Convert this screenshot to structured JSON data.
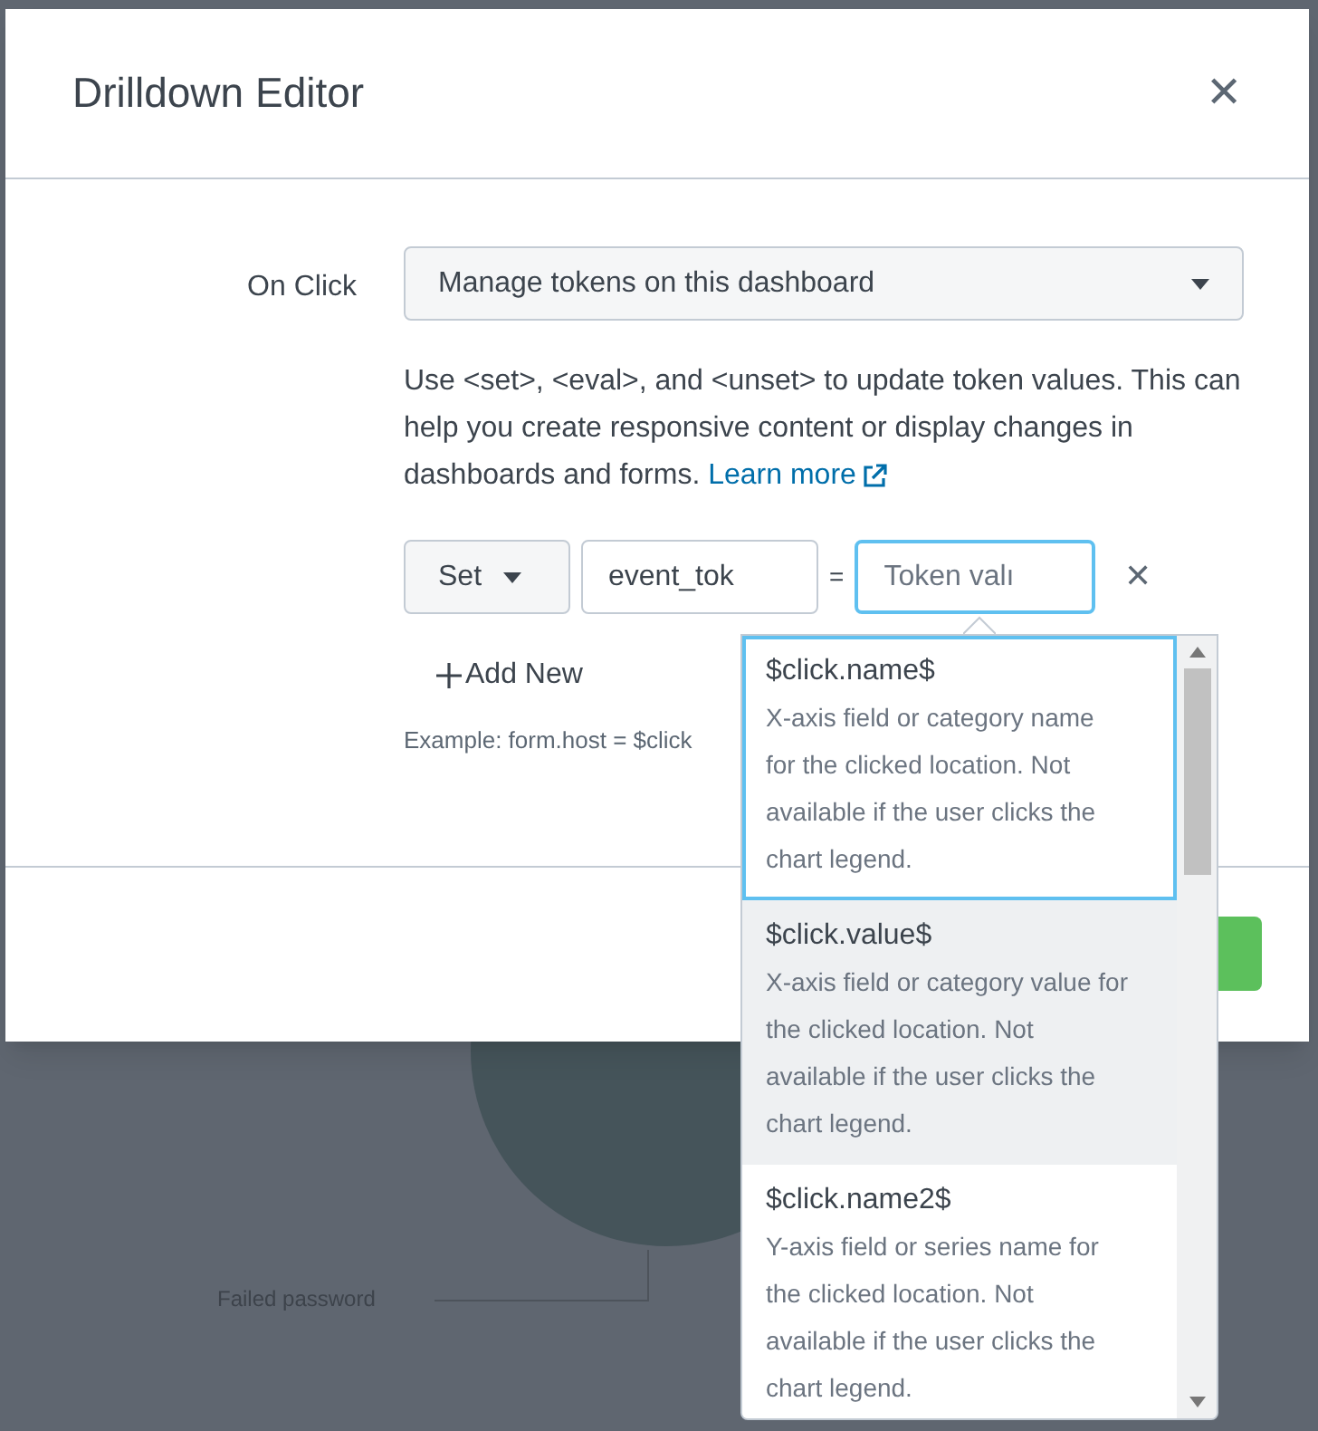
{
  "background": {
    "chart_label": "Failed password"
  },
  "dialog": {
    "title": "Drilldown Editor",
    "close": "✕",
    "on_click": {
      "label": "On Click",
      "value": "Manage tokens on this dashboard"
    },
    "help": {
      "text": "Use <set>, <eval>, and <unset> to update token values. This can help you create responsive content or display changes in dashboards and forms.",
      "link": "Learn more"
    },
    "token_row": {
      "action": "Set",
      "name": "event_tok",
      "equals": "=",
      "value_placeholder": "Token valı",
      "remove": "✕"
    },
    "add_new": "Add New",
    "example": "Example: form.host = $click"
  },
  "suggestions": [
    {
      "token": "$click.name$",
      "description": "X-axis field or category name for the clicked location. Not available if the user clicks the chart legend.",
      "selected": true,
      "hovered": false
    },
    {
      "token": "$click.value$",
      "description": "X-axis field or category value for the clicked location. Not available if the user clicks the chart legend.",
      "selected": false,
      "hovered": true
    },
    {
      "token": "$click.name2$",
      "description": "Y-axis field or series name for the clicked location. Not available if the user clicks the chart legend.",
      "selected": false,
      "hovered": false
    }
  ]
}
